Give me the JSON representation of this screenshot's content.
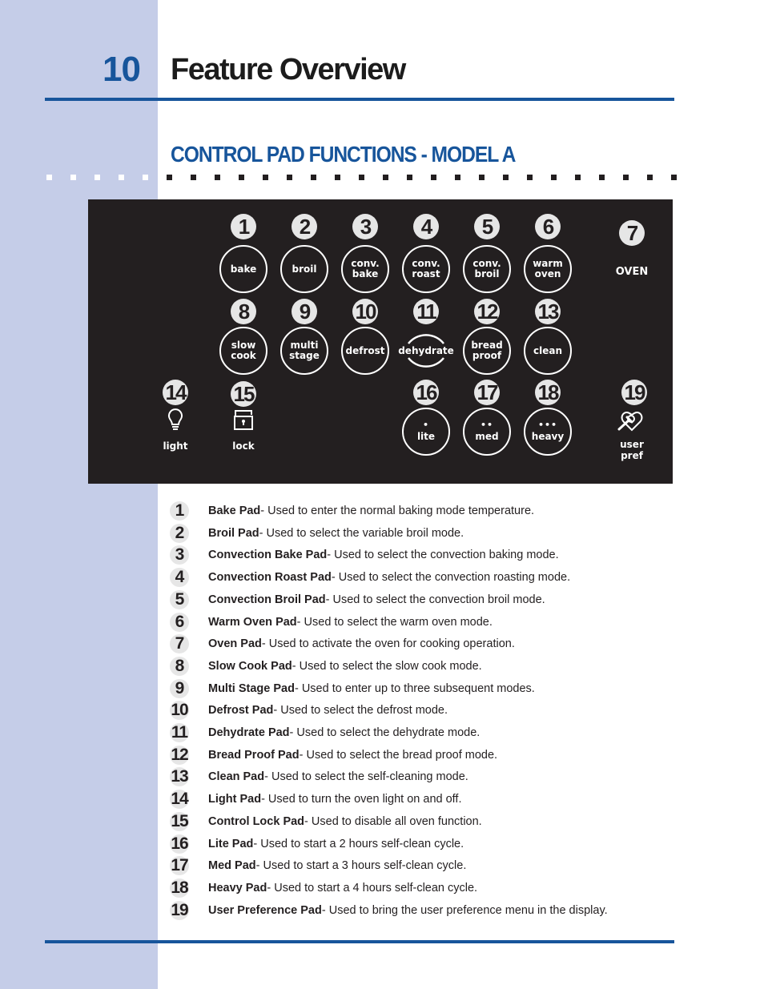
{
  "header": {
    "page_number": "10",
    "title": "Feature Overview"
  },
  "section": {
    "title": "CONTROL PAD FUNCTIONS - MODEL A"
  },
  "colors": {
    "accent_blue": "#17559b",
    "sidebar": "#c5cde8",
    "panel": "#231f20",
    "badge": "#e6e6e6"
  },
  "panel": {
    "pads": [
      {
        "number": "1",
        "lines": [
          "bake"
        ]
      },
      {
        "number": "2",
        "lines": [
          "broil"
        ]
      },
      {
        "number": "3",
        "lines": [
          "conv.",
          "bake"
        ]
      },
      {
        "number": "4",
        "lines": [
          "conv.",
          "roast"
        ]
      },
      {
        "number": "5",
        "lines": [
          "conv.",
          "broil"
        ]
      },
      {
        "number": "6",
        "lines": [
          "warm",
          "oven"
        ]
      },
      {
        "number": "7",
        "label": "OVEN"
      },
      {
        "number": "8",
        "lines": [
          "slow",
          "cook"
        ]
      },
      {
        "number": "9",
        "lines": [
          "multi",
          "stage"
        ]
      },
      {
        "number": "10",
        "lines": [
          "defrost"
        ]
      },
      {
        "number": "11",
        "lines": [
          "dehydrate"
        ]
      },
      {
        "number": "12",
        "lines": [
          "bread",
          "proof"
        ]
      },
      {
        "number": "13",
        "lines": [
          "clean"
        ]
      },
      {
        "number": "14",
        "label": "light",
        "icon": "lightbulb-icon"
      },
      {
        "number": "15",
        "label": "lock",
        "icon": "lock-icon"
      },
      {
        "number": "16",
        "lines": [
          "lite"
        ],
        "dots": "•"
      },
      {
        "number": "17",
        "lines": [
          "med"
        ],
        "dots": "••"
      },
      {
        "number": "18",
        "lines": [
          "heavy"
        ],
        "dots": "•••"
      },
      {
        "number": "19",
        "lines": [
          "user",
          "pref"
        ],
        "icon": "wrench-heart-icon"
      }
    ]
  },
  "descriptions": [
    {
      "number": "1",
      "name": "Bake Pad",
      "text": "- Used to enter the normal baking mode temperature."
    },
    {
      "number": "2",
      "name": "Broil Pad",
      "text": "- Used to select the variable broil mode."
    },
    {
      "number": "3",
      "name": "Convection Bake Pad",
      "text": "- Used to select the convection baking mode."
    },
    {
      "number": "4",
      "name": "Convection Roast Pad",
      "text": "- Used to select the convection roasting mode."
    },
    {
      "number": "5",
      "name": "Convection Broil Pad",
      "text": "- Used to select the convection broil mode."
    },
    {
      "number": "6",
      "name": "Warm Oven Pad",
      "text": "- Used to select the warm oven mode."
    },
    {
      "number": "7",
      "name": "Oven Pad",
      "text": "- Used to activate the oven for cooking operation."
    },
    {
      "number": "8",
      "name": "Slow Cook Pad",
      "text": "- Used to select the slow cook mode."
    },
    {
      "number": "9",
      "name": "Multi Stage Pad",
      "text": "- Used to enter up to three subsequent modes."
    },
    {
      "number": "10",
      "name": "Defrost Pad",
      "text": "- Used to select the defrost mode."
    },
    {
      "number": "11",
      "name": "Dehydrate Pad",
      "text": "- Used to select the dehydrate mode."
    },
    {
      "number": "12",
      "name": "Bread Proof Pad",
      "text": "- Used to select the bread proof mode."
    },
    {
      "number": "13",
      "name": "Clean Pad",
      "text": "- Used to select the self-cleaning mode."
    },
    {
      "number": "14",
      "name": "Light Pad",
      "text": "- Used to turn the oven light on and off."
    },
    {
      "number": "15",
      "name": "Control Lock Pad",
      "text": "- Used to disable all oven function."
    },
    {
      "number": "16",
      "name": "Lite Pad",
      "text": "- Used to start a 2 hours self-clean cycle."
    },
    {
      "number": "17",
      "name": "Med Pad",
      "text": "- Used to start a 3 hours self-clean cycle."
    },
    {
      "number": "18",
      "name": "Heavy Pad",
      "text": "- Used to start a 4 hours self-clean cycle."
    },
    {
      "number": "19",
      "name": "User Preference Pad",
      "text": "- Used to bring the user preference menu in the display."
    }
  ]
}
